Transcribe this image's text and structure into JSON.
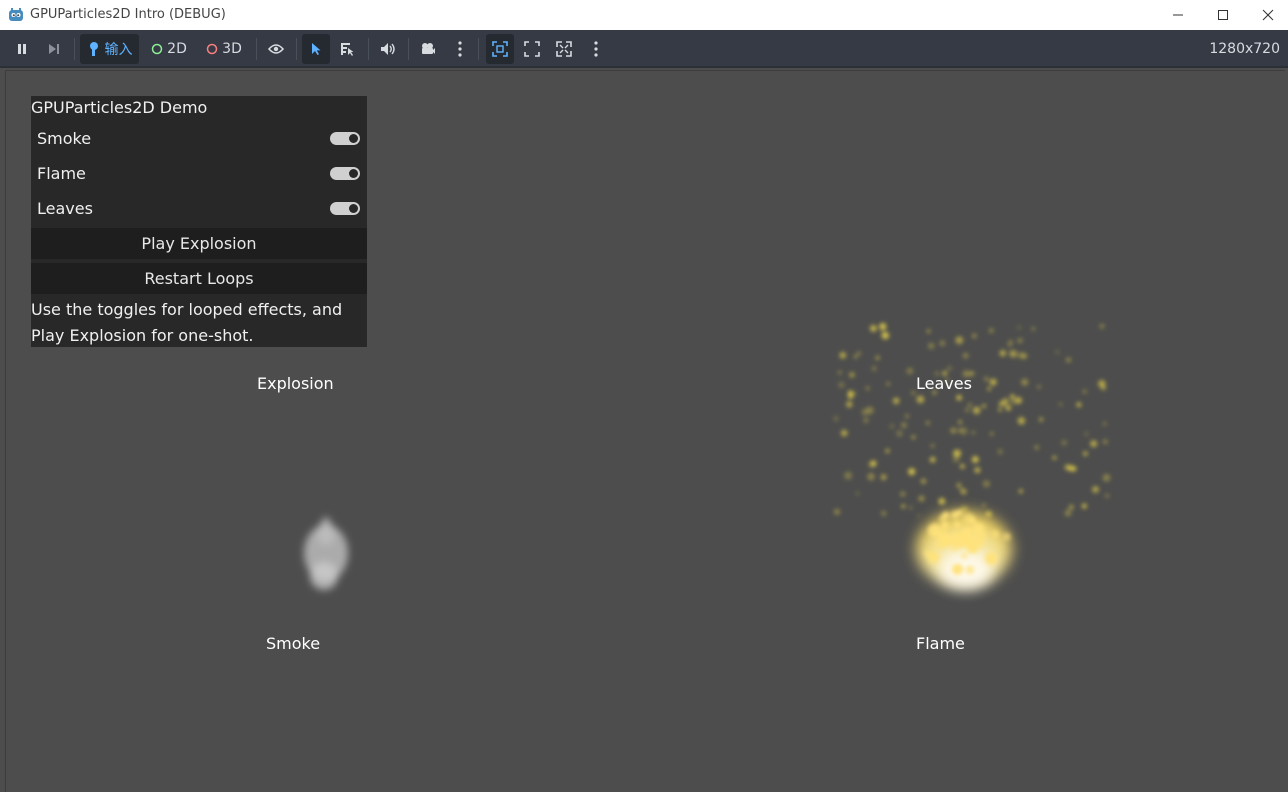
{
  "window": {
    "title": "GPUParticles2D Intro (DEBUG)"
  },
  "toolbar": {
    "input_label": "输入",
    "mode_2d_label": "2D",
    "mode_3d_label": "3D",
    "resolution": "1280x720"
  },
  "panel": {
    "title": "GPUParticles2D Demo",
    "toggles": [
      {
        "label": "Smoke",
        "on": true
      },
      {
        "label": "Flame",
        "on": true
      },
      {
        "label": "Leaves",
        "on": true
      }
    ],
    "play_explosion_label": "Play Explosion",
    "restart_loops_label": "Restart Loops",
    "description": "Use the toggles for looped effects, and Play Explosion for one-shot."
  },
  "scene_labels": {
    "explosion": "Explosion",
    "leaves": "Leaves",
    "smoke": "Smoke",
    "flame": "Flame"
  },
  "colors": {
    "accent": "#5fb2ff",
    "circle_2d": "#8eef97",
    "circle_3d": "#fc7f7f",
    "leaf": "#e6d24a",
    "flame": "#ffe27a",
    "smoke": "#b9b9b9"
  }
}
